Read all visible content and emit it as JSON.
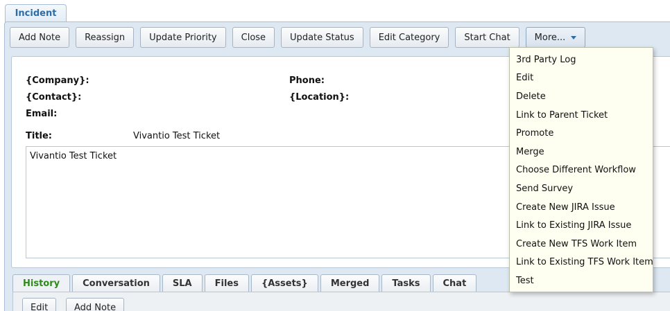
{
  "top_tab": {
    "label": "Incident"
  },
  "toolbar": {
    "buttons": [
      "Add Note",
      "Reassign",
      "Update Priority",
      "Close",
      "Update Status",
      "Edit Category",
      "Start Chat"
    ],
    "more_label": "More..."
  },
  "details": {
    "company_label": "{Company}:",
    "contact_label": "{Contact}:",
    "email_label": "Email:",
    "phone_label": "Phone:",
    "location_label": "{Location}:",
    "title_label": "Title:",
    "title_value": "Vivantio Test Ticket",
    "description": "Vivantio Test Ticket"
  },
  "more_menu": {
    "items": [
      "3rd Party Log",
      "Edit",
      "Delete",
      "Link to Parent Ticket",
      "Promote",
      "Merge",
      "Choose Different Workflow",
      "Send Survey",
      "Create New JIRA Issue",
      "Link to Existing JIRA Issue",
      "Create New TFS Work Item",
      "Link to Existing TFS Work Item",
      "Test"
    ]
  },
  "bottom_tabs": {
    "tabs": [
      "History",
      "Conversation",
      "SLA",
      "Files",
      "{Assets}",
      "Merged",
      "Tasks",
      "Chat"
    ],
    "active": "History"
  },
  "history": {
    "edit_label": "Edit",
    "add_note_label": "Add Note"
  },
  "colors": {
    "accent_blue": "#2e6ca6",
    "active_tab_green": "#2f8a1a",
    "menu_background": "#fefff0",
    "panel_background": "#dde8f3"
  }
}
